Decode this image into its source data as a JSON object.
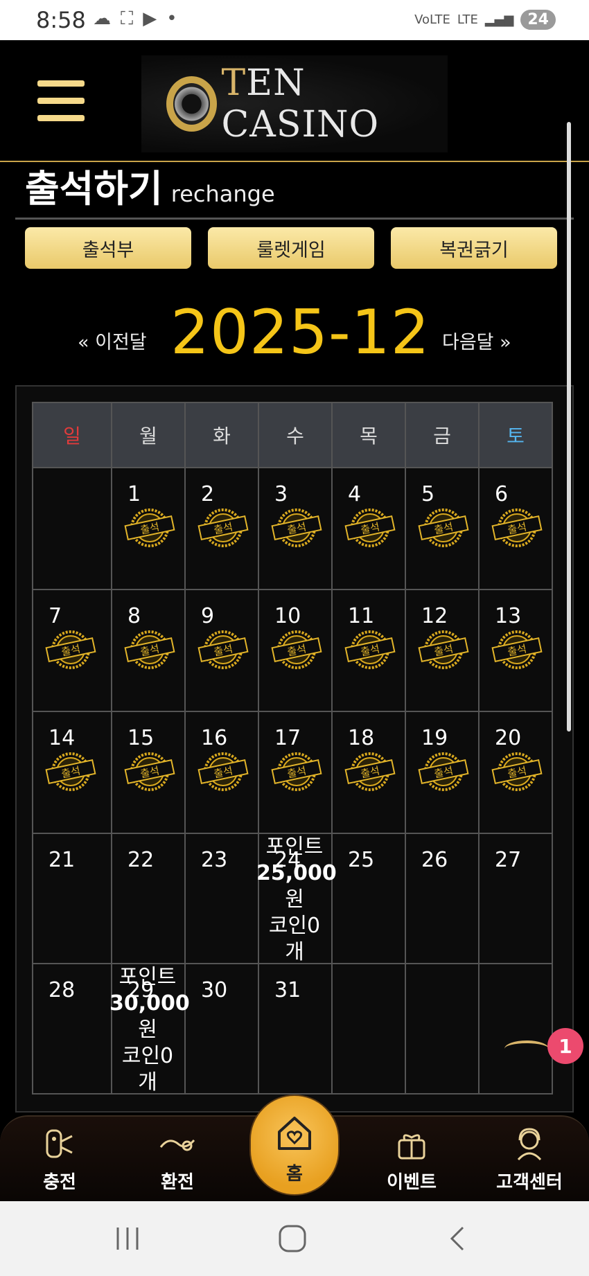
{
  "status_bar": {
    "time": "8:58",
    "network": "LTE",
    "battery": "24"
  },
  "header": {
    "logo_text_first": "T",
    "logo_text_rest": "EN CASINO"
  },
  "page": {
    "title": "출석하기",
    "subtitle": "rechange"
  },
  "tabs": [
    "출석부",
    "룰렛게임",
    "복권긁기"
  ],
  "month_nav": {
    "prev": "« 이전달",
    "current": "2025-12",
    "next": "다음달 »"
  },
  "calendar": {
    "weekdays": [
      "일",
      "월",
      "화",
      "수",
      "목",
      "금",
      "토"
    ],
    "weekday_colors": [
      "#e23b3b",
      "#dddddd",
      "#dddddd",
      "#dddddd",
      "#dddddd",
      "#dddddd",
      "#55b6f0"
    ],
    "stamp_text": "출석",
    "weeks": [
      [
        "",
        "1",
        "2",
        "3",
        "4",
        "5",
        "6"
      ],
      [
        "7",
        "8",
        "9",
        "10",
        "11",
        "12",
        "13"
      ],
      [
        "14",
        "15",
        "16",
        "17",
        "18",
        "19",
        "20"
      ],
      [
        "21",
        "22",
        "23",
        "24",
        "25",
        "26",
        "27"
      ],
      [
        "28",
        "29",
        "30",
        "31",
        "",
        "",
        ""
      ]
    ],
    "attended_days": [
      "1",
      "2",
      "3",
      "4",
      "5",
      "6",
      "7",
      "8",
      "9",
      "10",
      "11",
      "12",
      "13",
      "14",
      "15",
      "16",
      "17",
      "18",
      "19",
      "20"
    ],
    "rewards": {
      "24": {
        "line1": "포인트",
        "line2": "25,000",
        "line3": "원",
        "line4": "코인0",
        "line5": "개"
      },
      "29": {
        "line1": "포인트",
        "line2": "30,000",
        "line3": "원",
        "line4": "코인0",
        "line5": "개"
      }
    }
  },
  "floating_badge": "1",
  "bottom_tabs": {
    "charge": "충전",
    "exchange": "환전",
    "home": "홈",
    "event": "이벤트",
    "support": "고객센터"
  },
  "colors": {
    "accent_gold": "#f5c518",
    "button_gold": "#f3d98a",
    "badge_pink": "#ec4a6e"
  }
}
